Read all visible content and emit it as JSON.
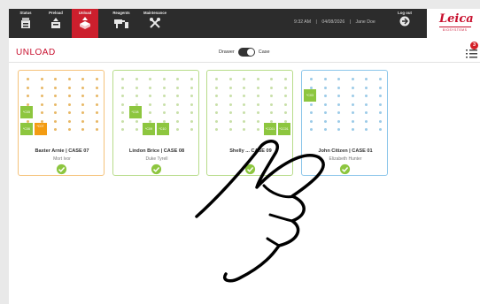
{
  "nav": {
    "tabs": [
      {
        "label": "Status",
        "icon": "status-icon"
      },
      {
        "label": "Preload",
        "icon": "preload-icon"
      },
      {
        "label": "Unload",
        "icon": "unload-icon",
        "active": true
      },
      {
        "label": "Reagents",
        "icon": "reagents-icon"
      },
      {
        "label": "Maintenance",
        "icon": "maintenance-icon"
      }
    ],
    "time": "9:32 AM",
    "date": "04/08/2026",
    "user": "Jane Doe",
    "logout_label": "Log out",
    "brand": {
      "word": "Leica",
      "sub": "BIOSYSTEMS"
    }
  },
  "header": {
    "title": "UNLOAD",
    "toggle_left": "Drawer",
    "toggle_right": "Case",
    "toggle_state": "Case",
    "badge_count": "3"
  },
  "colors": {
    "accent": "#c8102e",
    "nav_bg": "#2c2c2c",
    "slide_green": "#8dc63f",
    "slide_orange": "#f39c12",
    "border_orange": "#f5c27a",
    "border_green": "#b7dc8a",
    "border_blue": "#8cc6ea"
  },
  "cards": [
    {
      "name": "Baxter Arnie | CASE 07",
      "subtitle": "Mort Ivor",
      "border": "orange",
      "slides": [
        {
          "col": 0,
          "row": 4,
          "label": "*C05",
          "color": "green"
        },
        {
          "col": 0,
          "row": 6,
          "label": "*C06",
          "color": "green"
        },
        {
          "col": 1,
          "row": 6,
          "label": "*C07",
          "color": "orange"
        }
      ]
    },
    {
      "name": "Lindon Brice | CASE 08",
      "subtitle": "Duke Tyrell",
      "border": "green",
      "slides": [
        {
          "col": 1,
          "row": 4,
          "label": "*C08",
          "color": "green"
        },
        {
          "col": 2,
          "row": 6,
          "label": "*C09",
          "color": "green"
        },
        {
          "col": 3,
          "row": 6,
          "label": "*C10",
          "color": "green"
        }
      ]
    },
    {
      "name": "Shelly ... CASE 09",
      "subtitle": "",
      "border": "green",
      "slides": [
        {
          "col": 4,
          "row": 6,
          "label": "*CC01",
          "color": "green"
        },
        {
          "col": 5,
          "row": 6,
          "label": "*CC01",
          "color": "green"
        }
      ]
    },
    {
      "name": "John Citizen | CASE 01",
      "subtitle": "Elizabeth Hunter",
      "border": "blue",
      "slides": [
        {
          "col": 0,
          "row": 2,
          "label": "*C03",
          "color": "green"
        }
      ]
    }
  ]
}
